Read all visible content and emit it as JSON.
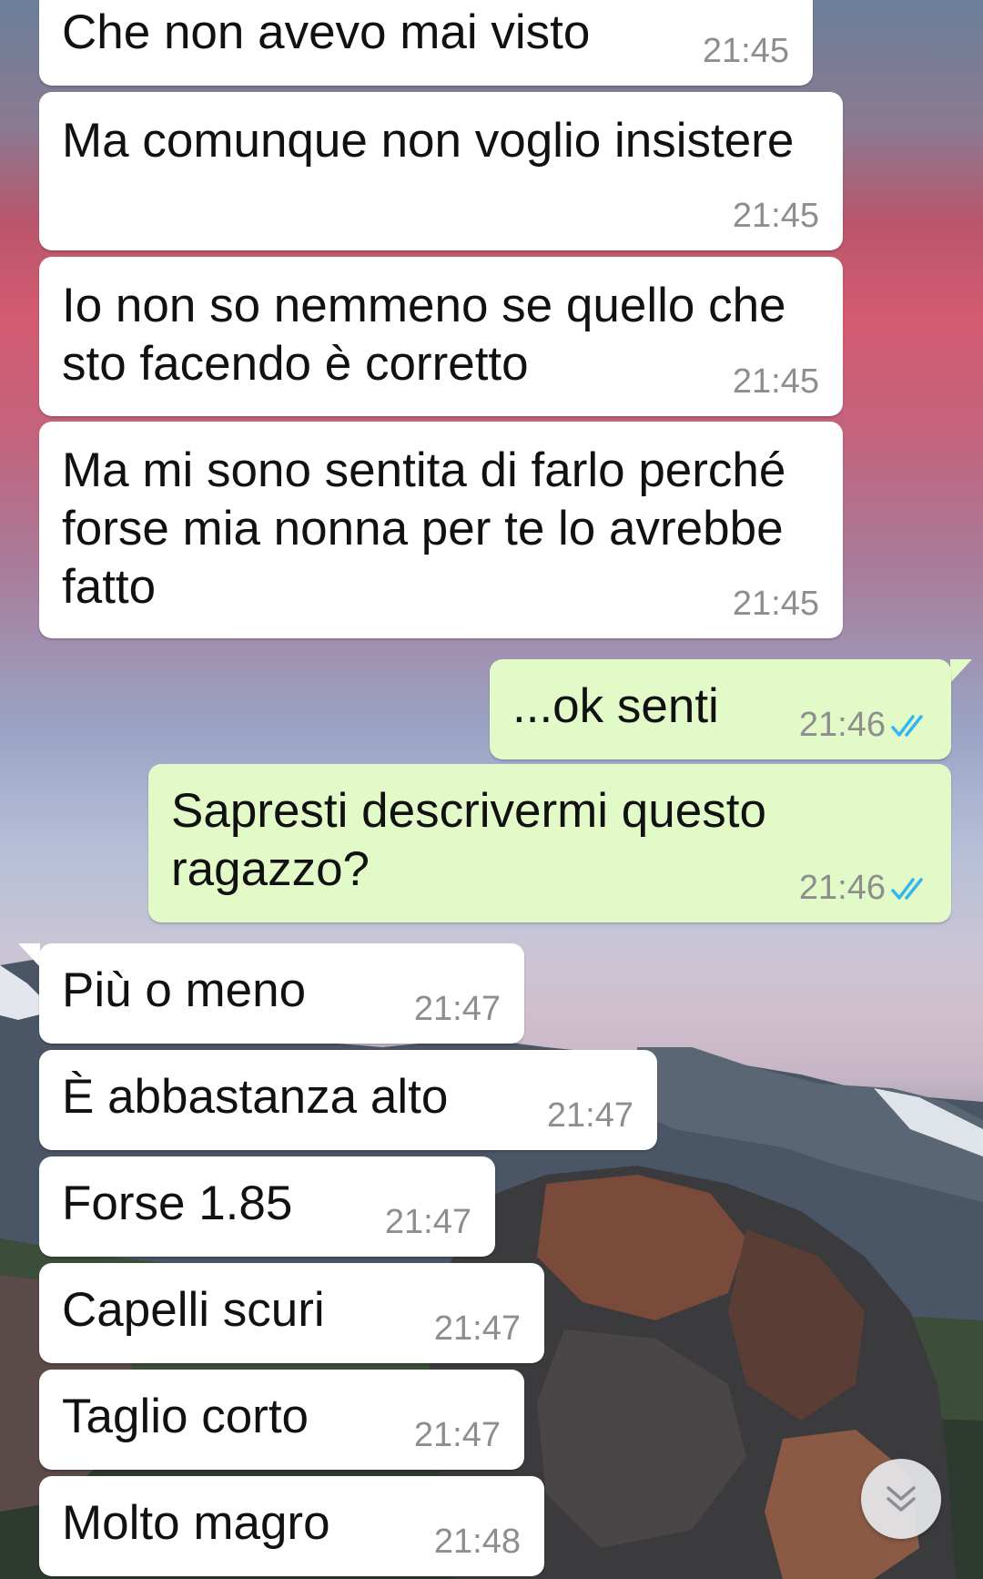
{
  "colors": {
    "incoming_bubble": "#ffffff",
    "outgoing_bubble": "#e2fac8",
    "timestamp": "#8e8e8e",
    "read_ticks": "#34b7f1"
  },
  "wallpaper": {
    "subject": "mountain-landscape-icon"
  },
  "messages": [
    {
      "direction": "incoming",
      "text": "Che non avevo mai visto",
      "time": "21:45"
    },
    {
      "direction": "incoming",
      "text": "Ma comunque non voglio insistere",
      "time": "21:45"
    },
    {
      "direction": "incoming",
      "text": "Io non so nemmeno se quello che\nsto facendo è corretto",
      "time": "21:45"
    },
    {
      "direction": "incoming",
      "text": "Ma mi sono sentita di farlo perché\nforse mia nonna per te lo avrebbe\nfatto",
      "time": "21:45"
    },
    {
      "direction": "outgoing",
      "text": "...ok senti",
      "time": "21:46",
      "status": "double-check-read-icon"
    },
    {
      "direction": "outgoing",
      "text": "Sapresti descrivermi questo\nragazzo?",
      "time": "21:46",
      "status": "double-check-read-icon"
    },
    {
      "direction": "incoming",
      "text": "Più o meno",
      "time": "21:47"
    },
    {
      "direction": "incoming",
      "text": "È abbastanza alto",
      "time": "21:47"
    },
    {
      "direction": "incoming",
      "text": "Forse 1.85",
      "time": "21:47"
    },
    {
      "direction": "incoming",
      "text": "Capelli scuri",
      "time": "21:47"
    },
    {
      "direction": "incoming",
      "text": "Taglio corto",
      "time": "21:47"
    },
    {
      "direction": "incoming",
      "text": "Molto magro",
      "time": "21:48"
    }
  ],
  "scroll_button": {
    "icon": "double-chevron-down-icon"
  }
}
